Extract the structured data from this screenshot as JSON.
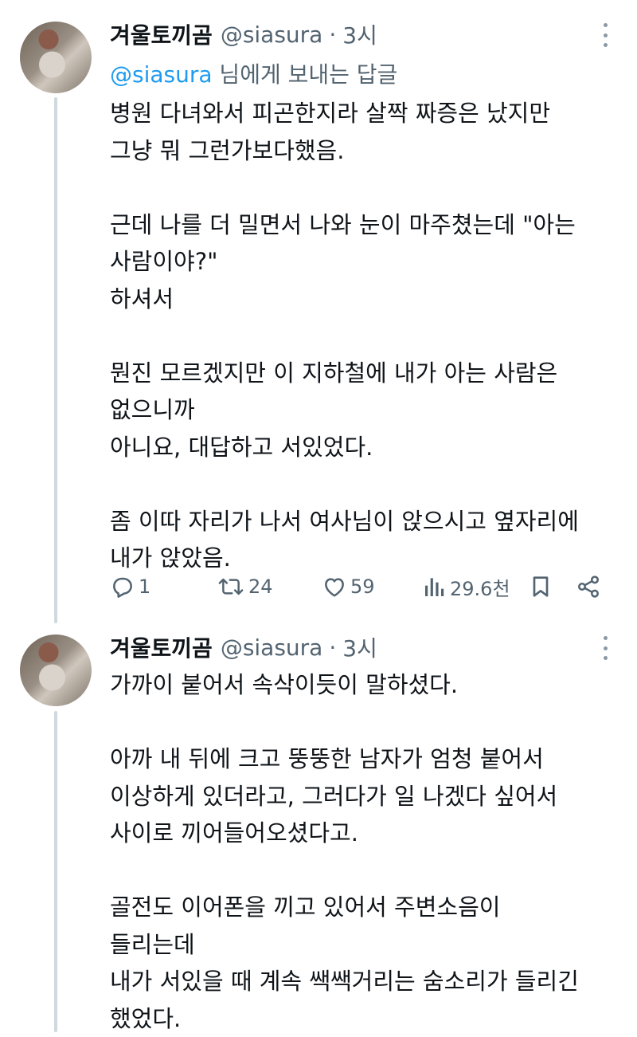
{
  "tweets": [
    {
      "name": "겨울토끼곰",
      "handle": "@siasura",
      "separator": "·",
      "time": "3시",
      "replying_prefix": "@siasura",
      "replying_suffix": " 님에게 보내는 답글",
      "lines": [
        "병원 다녀와서 피곤한지라 살짝 짜증은 났지만",
        "그냥 뭐 그런가보다했음.",
        "",
        "근데 나를 더 밀면서 나와 눈이 마주쳤는데 \"아는",
        "사람이야?\"",
        "하셔서",
        "",
        "뭔진 모르겠지만 이 지하철에 내가 아는 사람은",
        "없으니까",
        "아니요, 대답하고 서있었다.",
        "",
        "좀 이따 자리가 나서 여사님이 앉으시고 옆자리에",
        "내가 앉았음."
      ],
      "stats": {
        "replies": "1",
        "retweets": "24",
        "likes": "59",
        "views": "29.6천"
      }
    },
    {
      "name": "겨울토끼곰",
      "handle": "@siasura",
      "separator": "·",
      "time": "3시",
      "lines": [
        "가까이 붙어서 속삭이듯이 말하셨다.",
        "",
        "아까 내 뒤에 크고 뚱뚱한 남자가 엄청 붙어서",
        "이상하게 있더라고, 그러다가 일 나겠다 싶어서",
        "사이로 끼어들어오셨다고.",
        "",
        "골전도 이어폰을 끼고 있어서 주변소음이",
        "들리는데",
        "내가 서있을 때 계속 쌕쌕거리는 숨소리가 들리긴",
        "했었다."
      ]
    }
  ],
  "icons": {
    "reply": "reply-icon",
    "retweet": "retweet-icon",
    "like": "heart-icon",
    "views": "views-icon",
    "bookmark": "bookmark-icon",
    "share": "share-icon",
    "more": "more-icon"
  },
  "colors": {
    "text": "#0f1419",
    "secondary": "#536471",
    "mention": "#1d9bf0",
    "thread_line": "#cfd9de"
  }
}
